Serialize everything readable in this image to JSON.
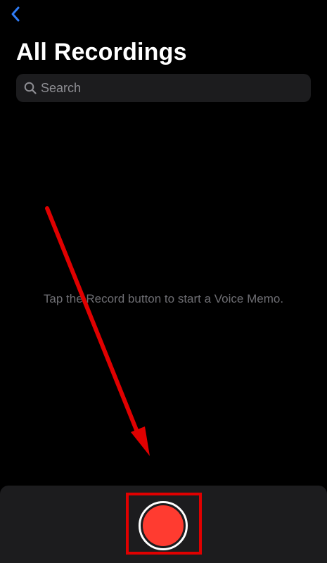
{
  "nav": {
    "back_icon": "chevron-left-icon",
    "accent_color": "#2f7cf6"
  },
  "header": {
    "title": "All Recordings"
  },
  "search": {
    "icon": "search-icon",
    "placeholder": "Search",
    "value": ""
  },
  "main": {
    "empty_message": "Tap the Record button to start a Voice Memo."
  },
  "recorder": {
    "record_button_icon": "record-icon",
    "record_color": "#ff3b30"
  },
  "annotation": {
    "color": "#e00000",
    "arrow_icon": "arrow-icon",
    "highlight": "record-button"
  }
}
